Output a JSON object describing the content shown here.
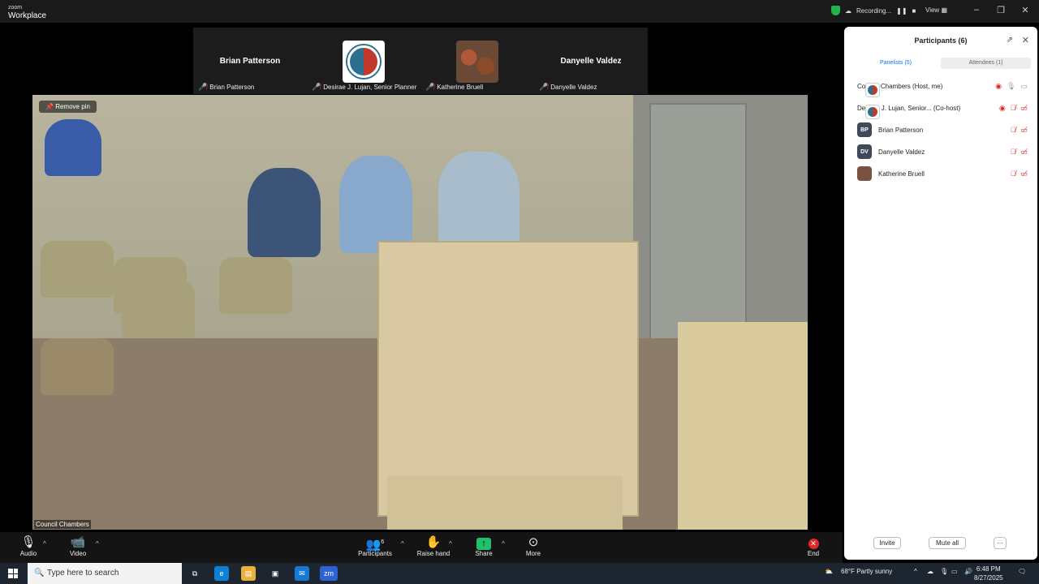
{
  "app": {
    "brand_small": "zoom",
    "brand_big": "Workplace"
  },
  "titlebar": {
    "recording": "Recording...",
    "view": "View"
  },
  "gallery": [
    {
      "name": "Brian Patterson",
      "label": "Brian Patterson"
    },
    {
      "name": "",
      "label": "Desirae J. Lujan, Senior Planner"
    },
    {
      "name": "",
      "label": "Katherine Bruell"
    },
    {
      "name": "Danyelle Valdez",
      "label": "Danyelle Valdez"
    }
  ],
  "video": {
    "remove_pin": "Remove pin",
    "name": "Council Chambers"
  },
  "controls": {
    "audio": "Audio",
    "video": "Video",
    "participants": "Participants",
    "participants_count": "6",
    "raise_hand": "Raise hand",
    "share": "Share",
    "more": "More",
    "end": "End"
  },
  "panel": {
    "title": "Participants (6)",
    "tabs": [
      "Panelists (5)",
      "Attendees (1)"
    ],
    "participants": [
      {
        "name": "Council Chambers (Host, me)",
        "initials": ""
      },
      {
        "name": "Desirae J. Lujan, Senior... (Co-host)",
        "initials": ""
      },
      {
        "name": "Brian Patterson",
        "initials": "BP"
      },
      {
        "name": "Danyelle Valdez",
        "initials": "DV"
      },
      {
        "name": "Katherine Bruell",
        "initials": ""
      }
    ],
    "invite": "Invite",
    "mute_all": "Mute all",
    "more": "···"
  },
  "taskbar": {
    "search_placeholder": "Type here to search",
    "weather": "68°F  Partly sunny",
    "time": "6:48 PM",
    "date": "8/27/2025"
  },
  "colors": {
    "accent": "#0e71eb",
    "muted": "#e02828",
    "share": "#1fc26b"
  }
}
